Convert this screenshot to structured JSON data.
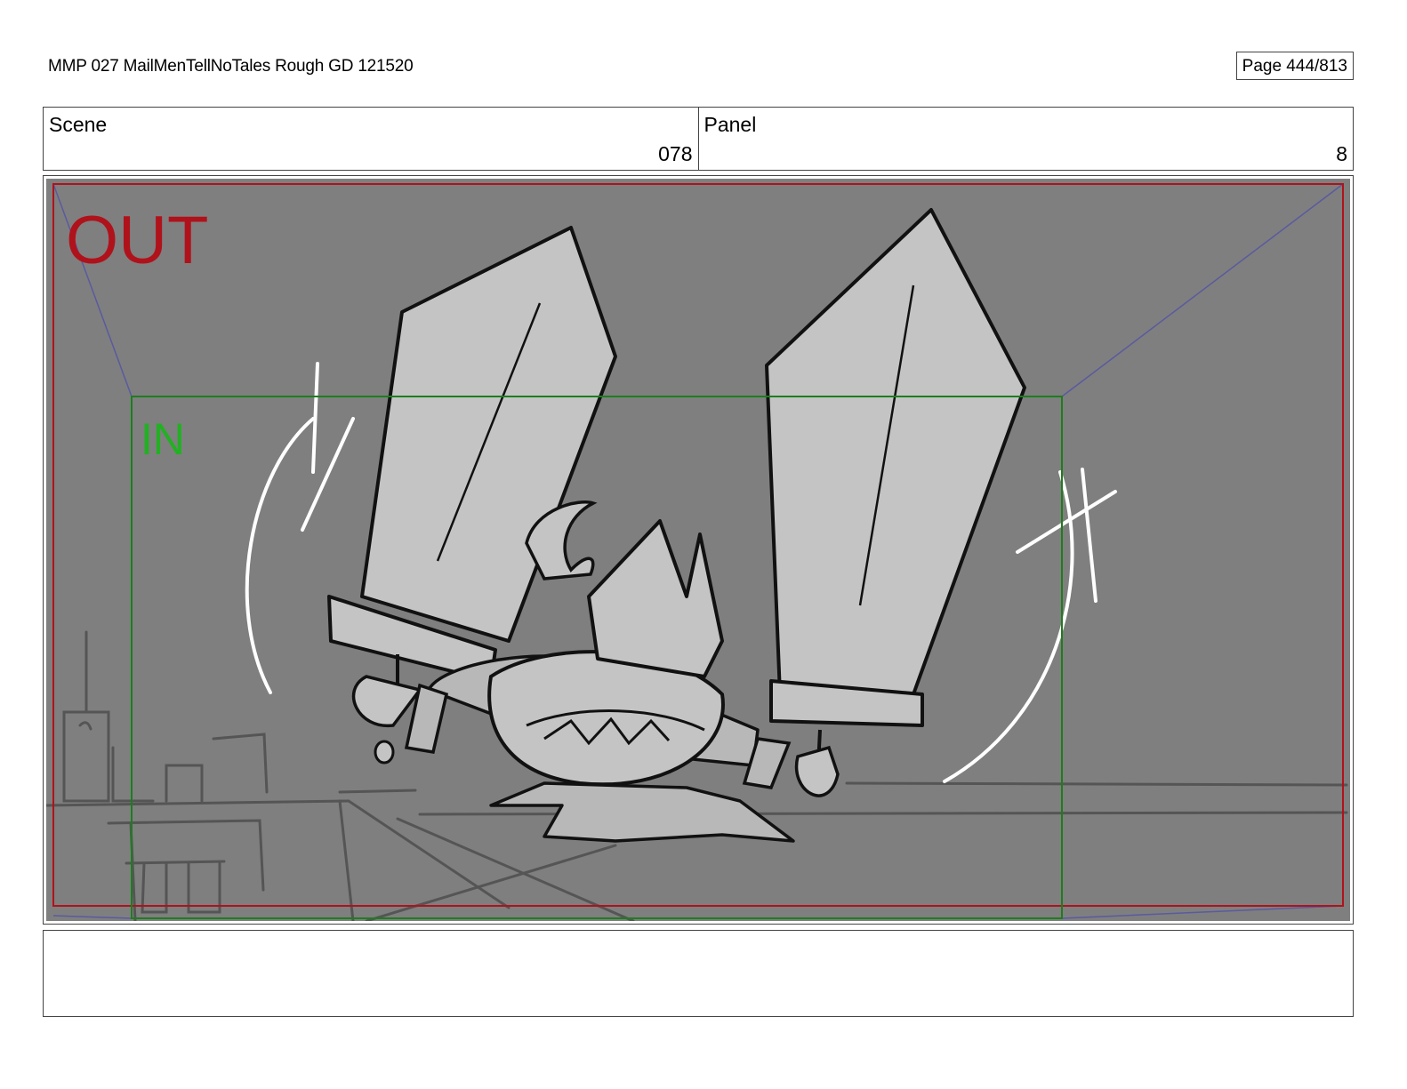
{
  "header": {
    "title": "MMP 027 MailMenTellNoTales Rough GD 121520",
    "page": "Page 444/813"
  },
  "info": {
    "scene_label": "Scene",
    "scene_value": "078",
    "panel_label": "Panel",
    "panel_value": "8"
  },
  "panel": {
    "out_label": "OUT",
    "in_label": "IN",
    "colors": {
      "background": "#7f7f7f",
      "out_frame": "#b0121b",
      "in_frame": "#1e7d1e",
      "in_text": "#22b122",
      "perspective_lines": "#5a5aa0",
      "blade_fill": "#c4c4c4",
      "ink": "#111111"
    }
  },
  "notes": {
    "text": ""
  }
}
